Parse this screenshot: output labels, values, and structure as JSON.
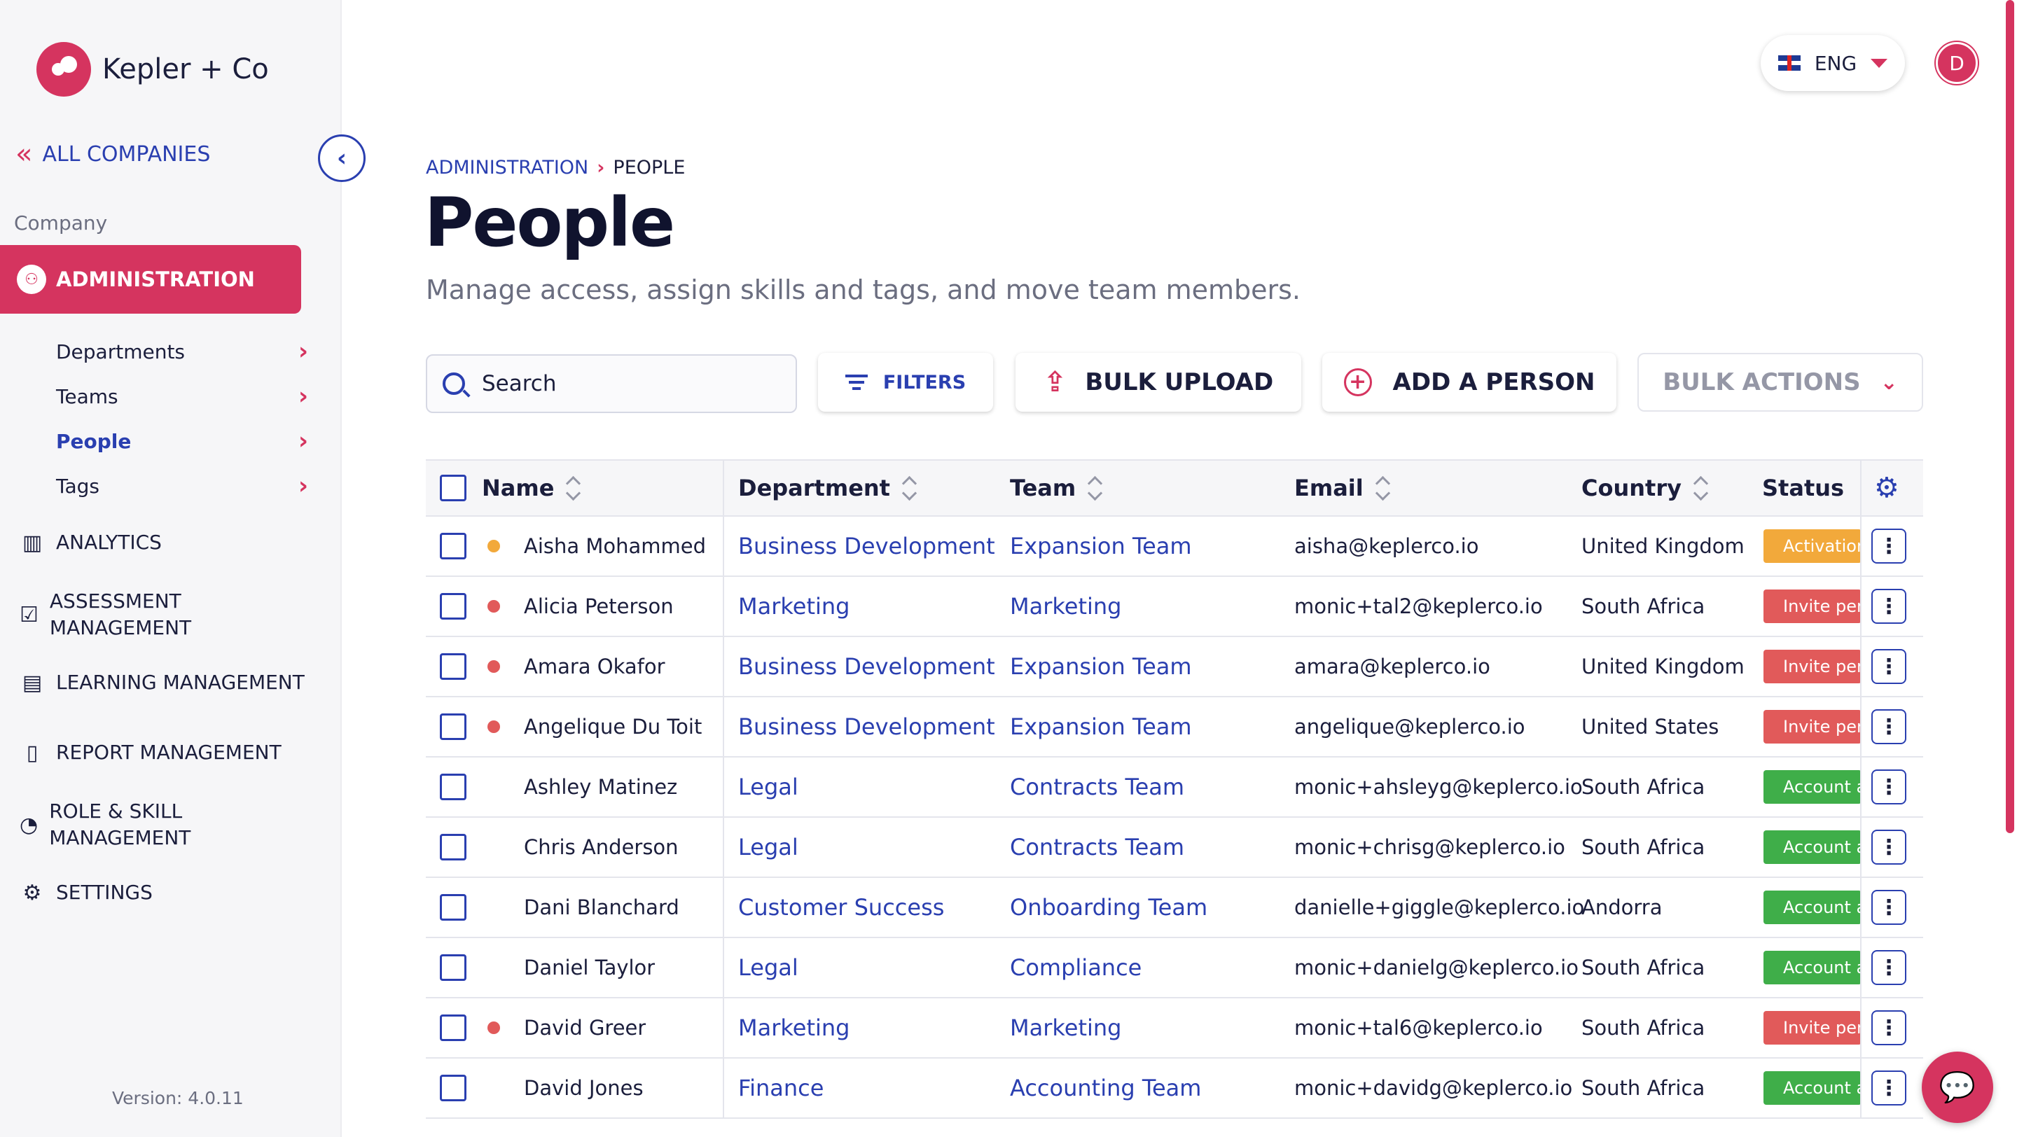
{
  "sidebar": {
    "logo_text": "Kepler + Co",
    "all_companies": "ALL COMPANIES",
    "company_label": "Company",
    "administration": "ADMINISTRATION",
    "sub_items": [
      {
        "label": "Departments"
      },
      {
        "label": "Teams"
      },
      {
        "label": "People"
      },
      {
        "label": "Tags"
      }
    ],
    "nav": [
      {
        "label": "ANALYTICS",
        "icon": "bar-chart-icon"
      },
      {
        "label": "ASSESSMENT MANAGEMENT",
        "icon": "clipboard-check-icon"
      },
      {
        "label": "LEARNING MANAGEMENT",
        "icon": "learning-icon"
      },
      {
        "label": "REPORT MANAGEMENT",
        "icon": "report-icon"
      },
      {
        "label": "ROLE & SKILL MANAGEMENT",
        "icon": "role-skill-icon"
      },
      {
        "label": "SETTINGS",
        "icon": "gear-icon"
      }
    ],
    "version": "Version: 4.0.11"
  },
  "topbar": {
    "language": "ENG",
    "avatar_initial": "D"
  },
  "header": {
    "breadcrumb": [
      "ADMINISTRATION",
      "PEOPLE"
    ],
    "title": "People",
    "subtitle": "Manage access, assign skills and tags, and move team members."
  },
  "toolbar": {
    "search_placeholder": "Search",
    "filters": "FILTERS",
    "bulk_upload": "BULK UPLOAD",
    "add_person": "ADD A PERSON",
    "bulk_actions": "BULK ACTIONS"
  },
  "table": {
    "columns": [
      "Name",
      "Department",
      "Team",
      "Email",
      "Country",
      "Status"
    ],
    "rows": [
      {
        "dot": "#f2a93b",
        "name": "Aisha Mohammed",
        "department": "Business Development",
        "team": "Expansion Team",
        "email": "aisha@keplerco.io",
        "country": "United Kingdom",
        "status": "Activation",
        "status_color": "#f2a93b"
      },
      {
        "dot": "#e15a5a",
        "name": "Alicia Peterson",
        "department": "Marketing",
        "team": "Marketing",
        "email": "monic+tal2@keplerco.io",
        "country": "South Africa",
        "status": "Invite pen",
        "status_color": "#e15a5a"
      },
      {
        "dot": "#e15a5a",
        "name": "Amara Okafor",
        "department": "Business Development",
        "team": "Expansion Team",
        "email": "amara@keplerco.io",
        "country": "United Kingdom",
        "status": "Invite pen",
        "status_color": "#e15a5a"
      },
      {
        "dot": "#e15a5a",
        "name": "Angelique Du Toit",
        "department": "Business Development",
        "team": "Expansion Team",
        "email": "angelique@keplerco.io",
        "country": "United States",
        "status": "Invite pen",
        "status_color": "#e15a5a"
      },
      {
        "dot": "",
        "name": "Ashley Matinez",
        "department": "Legal",
        "team": "Contracts Team",
        "email": "monic+ahsleyg@keplerco.io",
        "country": "South Africa",
        "status": "Account a",
        "status_color": "#3fae49"
      },
      {
        "dot": "",
        "name": "Chris Anderson",
        "department": "Legal",
        "team": "Contracts Team",
        "email": "monic+chrisg@keplerco.io",
        "country": "South Africa",
        "status": "Account a",
        "status_color": "#3fae49"
      },
      {
        "dot": "",
        "name": "Dani Blanchard",
        "department": "Customer Success",
        "team": "Onboarding Team",
        "email": "danielle+giggle@keplerco.io",
        "country": "Andorra",
        "status": "Account a",
        "status_color": "#3fae49"
      },
      {
        "dot": "",
        "name": "Daniel Taylor",
        "department": "Legal",
        "team": "Compliance",
        "email": "monic+danielg@keplerco.io",
        "country": "South Africa",
        "status": "Account a",
        "status_color": "#3fae49"
      },
      {
        "dot": "#e15a5a",
        "name": "David Greer",
        "department": "Marketing",
        "team": "Marketing",
        "email": "monic+tal6@keplerco.io",
        "country": "South Africa",
        "status": "Invite pen",
        "status_color": "#e15a5a"
      },
      {
        "dot": "",
        "name": "David Jones",
        "department": "Finance",
        "team": "Accounting Team",
        "email": "monic+davidg@keplerco.io",
        "country": "South Africa",
        "status": "Account a",
        "status_color": "#3fae49"
      }
    ]
  },
  "colors": {
    "brand": "#d5345f",
    "accent": "#2a3fb0"
  }
}
